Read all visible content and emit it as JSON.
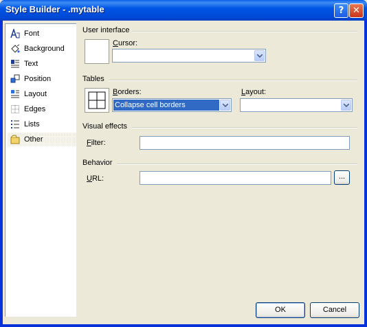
{
  "window": {
    "title": "Style Builder - .mytable"
  },
  "titlebar": {
    "help_icon": "?",
    "close_icon": "✕"
  },
  "sidebar": {
    "items": [
      {
        "label": "Font",
        "icon": "font-icon"
      },
      {
        "label": "Background",
        "icon": "background-icon"
      },
      {
        "label": "Text",
        "icon": "text-icon"
      },
      {
        "label": "Position",
        "icon": "position-icon"
      },
      {
        "label": "Layout",
        "icon": "layout-icon"
      },
      {
        "label": "Edges",
        "icon": "edges-icon"
      },
      {
        "label": "Lists",
        "icon": "lists-icon"
      },
      {
        "label": "Other",
        "icon": "other-icon",
        "selected": true
      }
    ]
  },
  "user_interface": {
    "title": "User interface",
    "cursor_label_key": "C",
    "cursor_label_rest": "ursor:",
    "cursor_value": ""
  },
  "tables": {
    "title": "Tables",
    "borders_label_key": "B",
    "borders_label_rest": "orders:",
    "borders_value": "Collapse cell borders",
    "layout_label_key": "L",
    "layout_label_rest": "ayout:",
    "layout_value": ""
  },
  "visual_effects": {
    "title": "Visual effects",
    "filter_label_key": "F",
    "filter_label_rest": "ilter:",
    "filter_value": ""
  },
  "behavior": {
    "title": "Behavior",
    "url_label_key": "U",
    "url_label_rest": "RL:",
    "url_value": "",
    "browse_label": "..."
  },
  "footer": {
    "ok_label": "OK",
    "cancel_label": "Cancel"
  },
  "colors": {
    "title_bar": "#0055e5",
    "face": "#ece9d8",
    "selection": "#316ac5",
    "close": "#c8341a"
  }
}
